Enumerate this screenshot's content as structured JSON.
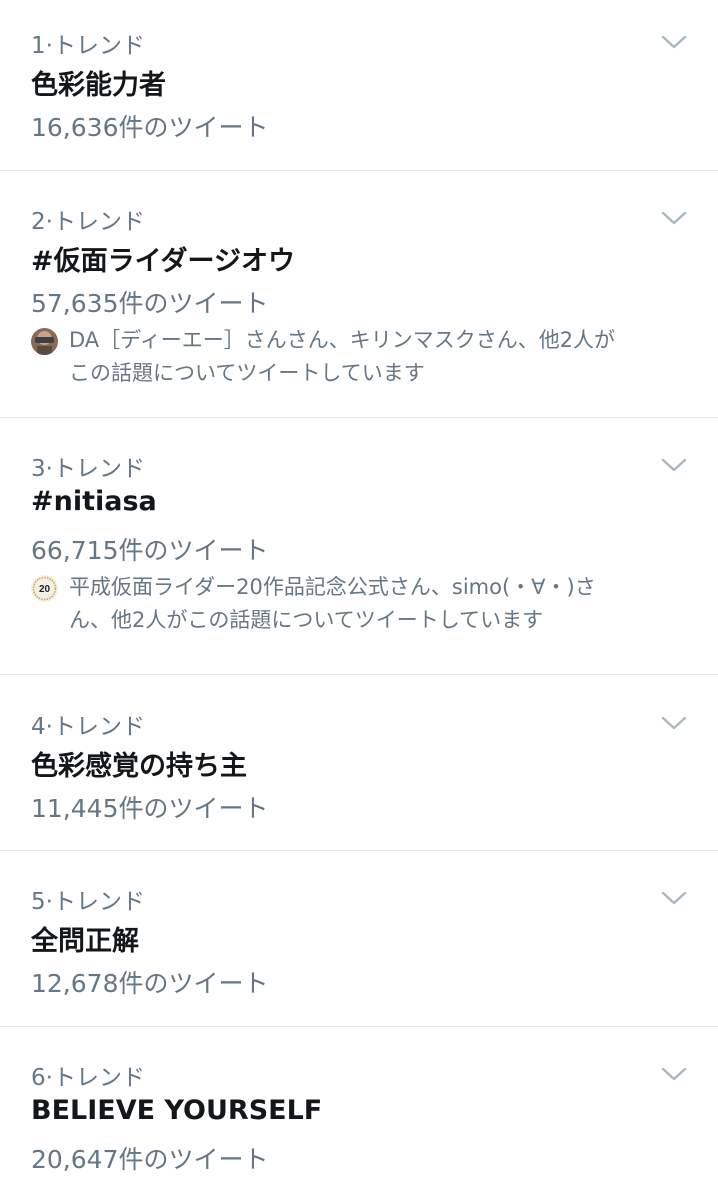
{
  "trends": [
    {
      "rank_label": "1·トレンド",
      "name": "色彩能力者",
      "tweet_count": "16,636件のツイート"
    },
    {
      "rank_label": "2·トレンド",
      "name": "#仮面ライダージオウ",
      "tweet_count": "57,635件のツイート",
      "context_line1": "DA［ディーエー］さんさん、キリンマスクさん、他2人が",
      "context_line2": "この話題についてツイートしています"
    },
    {
      "rank_label": "3·トレンド",
      "name": "#nitiasa",
      "tweet_count": "66,715件のツイート",
      "context_line1": "平成仮面ライダー20作品記念公式さん、simo(・∀・)さ",
      "context_line2": "ん、他2人がこの話題についてツイートしています",
      "avatar_text": "20"
    },
    {
      "rank_label": "4·トレンド",
      "name": "色彩感覚の持ち主",
      "tweet_count": "11,445件のツイート"
    },
    {
      "rank_label": "5·トレンド",
      "name": "全問正解",
      "tweet_count": "12,678件のツイート"
    },
    {
      "rank_label": "6·トレンド",
      "name": "BELIEVE YOURSELF",
      "tweet_count": "20,647件のツイート"
    }
  ],
  "icons": {
    "chevron": "chevron-down-icon",
    "avatar_user": "avatar",
    "avatar_logo": "avatar-logo"
  },
  "colors": {
    "primary_text": "#14171a",
    "secondary_text": "#657786",
    "divider": "#e1e8ed",
    "chevron": "#aab8c2"
  }
}
